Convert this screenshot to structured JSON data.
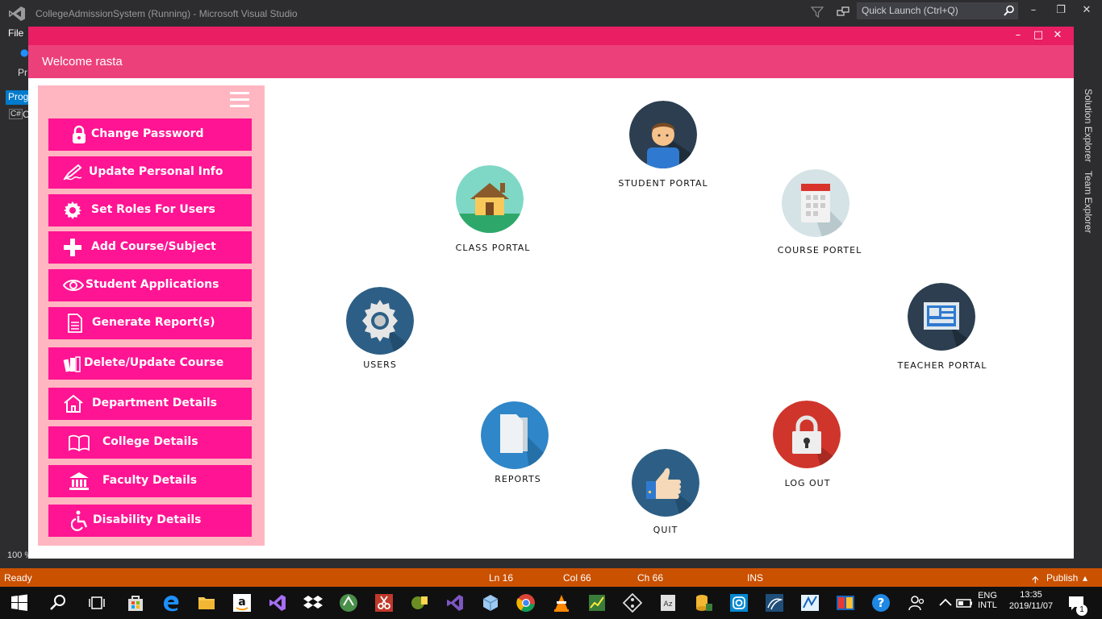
{
  "vs": {
    "title": "CollegeAdmissionSystem (Running) - Microsoft Visual Studio",
    "quick_launch_placeholder": "Quick Launch (Ctrl+Q)",
    "menu_file": "File",
    "side_pr": "Pr",
    "side_prog": "Prog",
    "side_cs_badge": "C#",
    "side_cs_text": "C",
    "zoom": "100 %",
    "solution_explorer": "Solution Explorer",
    "team_explorer": "Team Explorer",
    "status": {
      "ready": "Ready",
      "ln": "Ln 16",
      "col": "Col 66",
      "ch": "Ch 66",
      "ins": "INS",
      "publish": "Publish"
    }
  },
  "app": {
    "welcome": "Welcome rasta",
    "menu": [
      {
        "label": "Change Password",
        "icon": "lock-icon"
      },
      {
        "label": "Update Personal Info",
        "icon": "edit-pen-icon"
      },
      {
        "label": "Set Roles For Users",
        "icon": "gear-icon"
      },
      {
        "label": "Add Course/Subject",
        "icon": "plus-icon"
      },
      {
        "label": "Student Applications",
        "icon": "eye-icon"
      },
      {
        "label": "Generate Report(s)",
        "icon": "document-icon"
      },
      {
        "label": "Delete/Update Course",
        "icon": "books-icon"
      },
      {
        "label": "Department Details",
        "icon": "home-icon"
      },
      {
        "label": "College Details",
        "icon": "open-book-icon"
      },
      {
        "label": "Faculty Details",
        "icon": "institution-icon"
      },
      {
        "label": "Disability Details",
        "icon": "wheelchair-icon"
      }
    ],
    "portals": {
      "student": "STUDENT PORTAL",
      "class": "CLASS PORTAL",
      "course": "COURSE PORTEL",
      "users": "USERS",
      "teacher": "TEACHER PORTAL",
      "reports": "REPORTS",
      "logout": "LOG OUT",
      "quit": "QUIT"
    }
  },
  "taskbar": {
    "lang_top": "ENG",
    "lang_bottom": "INTL",
    "time": "13:35",
    "date": "2019/11/07",
    "notif_count": "1"
  }
}
